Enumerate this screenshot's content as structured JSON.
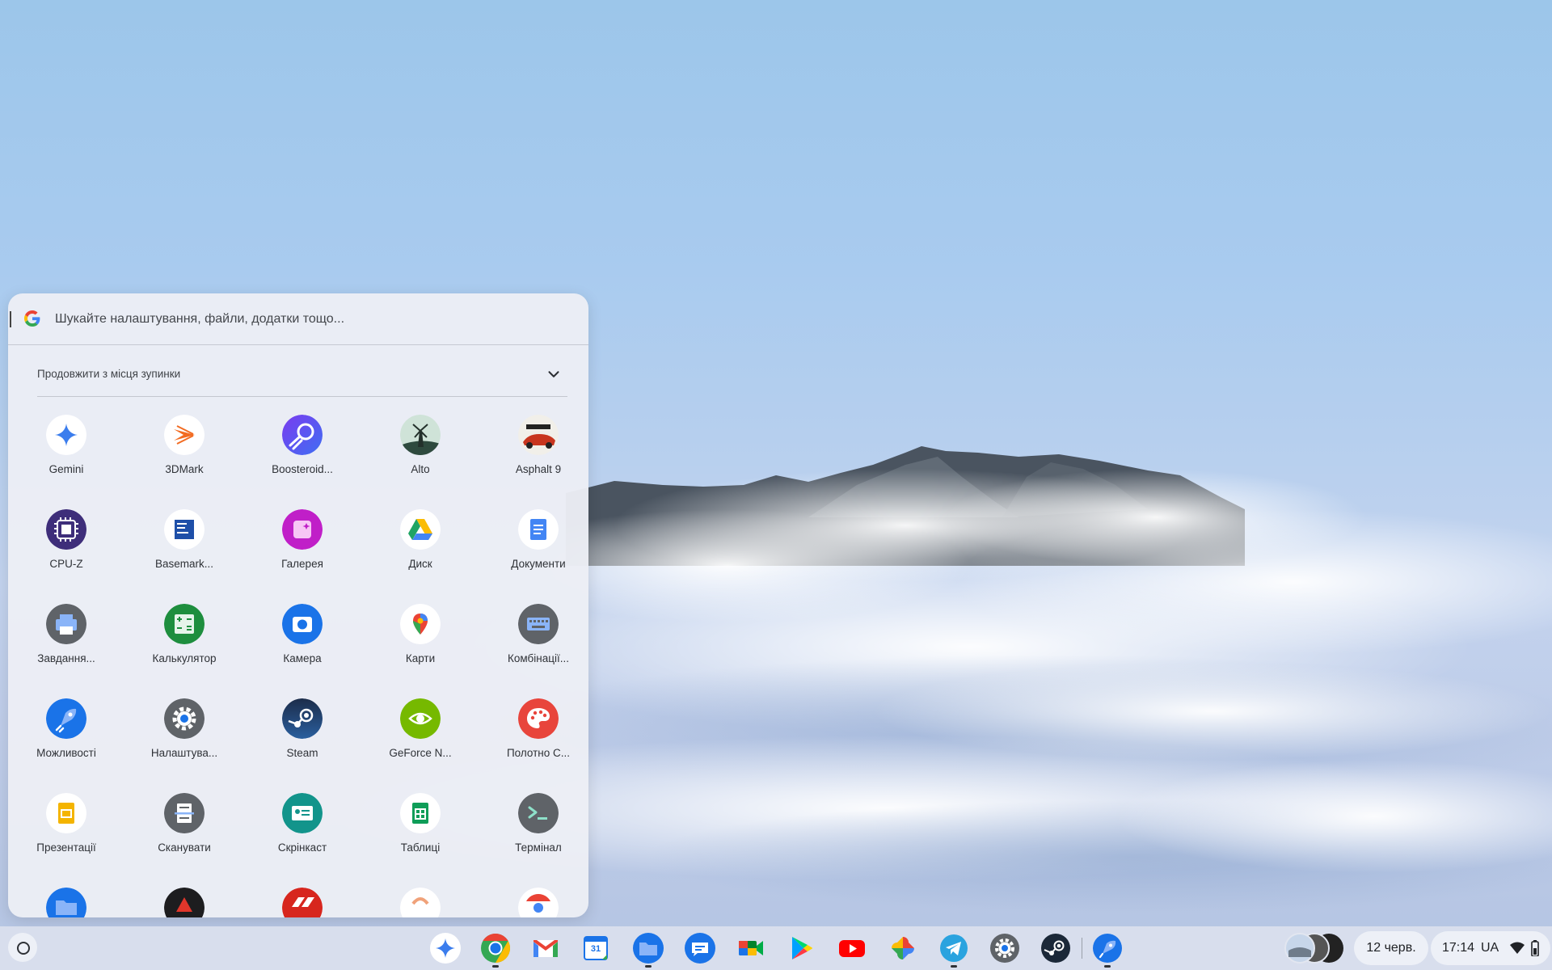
{
  "launcher": {
    "search_placeholder": "Шукайте налаштування, файли, додатки тощо...",
    "continue_label": "Продовжити з місця зупинки",
    "apps": [
      {
        "label": "Gemini",
        "icon": "gemini-icon"
      },
      {
        "label": "3DMark",
        "icon": "3dmark-icon"
      },
      {
        "label": "Boosteroid...",
        "icon": "boosteroid-icon"
      },
      {
        "label": "Alto",
        "icon": "alto-icon"
      },
      {
        "label": "Asphalt 9",
        "icon": "asphalt-icon"
      },
      {
        "label": "CPU-Z",
        "icon": "cpuz-icon"
      },
      {
        "label": "Basemark...",
        "icon": "basemark-icon"
      },
      {
        "label": "Галерея",
        "icon": "gallery-icon"
      },
      {
        "label": "Диск",
        "icon": "drive-icon"
      },
      {
        "label": "Документи",
        "icon": "docs-icon"
      },
      {
        "label": "Завдання...",
        "icon": "print-jobs-icon"
      },
      {
        "label": "Калькулятор",
        "icon": "calculator-icon"
      },
      {
        "label": "Камера",
        "icon": "camera-icon"
      },
      {
        "label": "Карти",
        "icon": "maps-icon"
      },
      {
        "label": "Комбінації...",
        "icon": "shortcuts-icon"
      },
      {
        "label": "Можливості",
        "icon": "explore-icon"
      },
      {
        "label": "Налаштува...",
        "icon": "settings-icon"
      },
      {
        "label": "Steam",
        "icon": "steam-icon"
      },
      {
        "label": "GeForce N...",
        "icon": "geforce-icon"
      },
      {
        "label": "Полотно C...",
        "icon": "canvas-icon"
      },
      {
        "label": "Презентації",
        "icon": "slides-icon"
      },
      {
        "label": "Сканувати",
        "icon": "scan-icon"
      },
      {
        "label": "Скрінкаст",
        "icon": "screencast-icon"
      },
      {
        "label": "Таблиці",
        "icon": "sheets-icon"
      },
      {
        "label": "Термінал",
        "icon": "terminal-icon"
      }
    ]
  },
  "shelf": {
    "pinned": [
      "gemini-icon",
      "chrome-icon",
      "gmail-icon",
      "calendar-icon",
      "files-icon",
      "messages-icon",
      "meet-icon",
      "play-store-icon",
      "youtube-icon",
      "photos-icon",
      "telegram-icon",
      "settings-icon",
      "steam-icon",
      "explore-icon"
    ],
    "calendar_day": "31",
    "date": "12 черв.",
    "time": "17:14",
    "ime": "UA"
  },
  "colors": {
    "launcher_bg": "#eceef5",
    "shelf_bg": "#e2e6f0",
    "accent_blue": "#1a73e8"
  }
}
